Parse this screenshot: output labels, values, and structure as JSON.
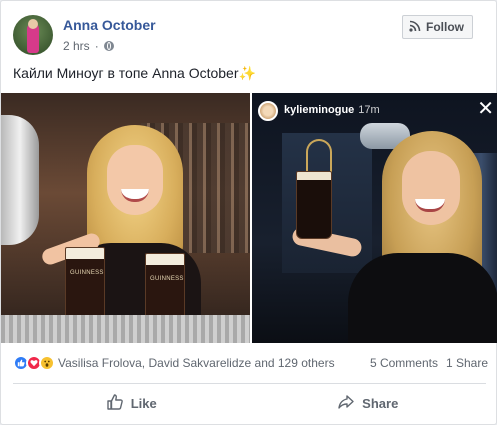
{
  "post": {
    "author": "Anna October",
    "time": "2 hrs",
    "privacy_icon": "globe-icon",
    "follow_label": "Follow",
    "text": "Кайли Миноуг в топе Anna October",
    "text_emoji": "✨"
  },
  "photos": [
    {
      "glass_label_1": "GUINNESS",
      "glass_label_2": "GUINNESS"
    },
    {
      "story_user": "kylieminogue",
      "story_time": "17m",
      "close_glyph": "✕"
    }
  ],
  "reactions": {
    "icons": [
      "like-icon",
      "love-icon",
      "wow-icon"
    ],
    "names": "Vasilisa Frolova, David Sakvarelidze and 129 others",
    "comments": "5 Comments",
    "shares": "1 Share"
  },
  "actions": {
    "like_label": "Like",
    "share_label": "Share"
  },
  "colors": {
    "link_blue": "#365899",
    "meta_gray": "#606770",
    "like_blue": "#2f7cf6",
    "love_red": "#f0284a",
    "wow_yellow": "#f7c12f"
  }
}
